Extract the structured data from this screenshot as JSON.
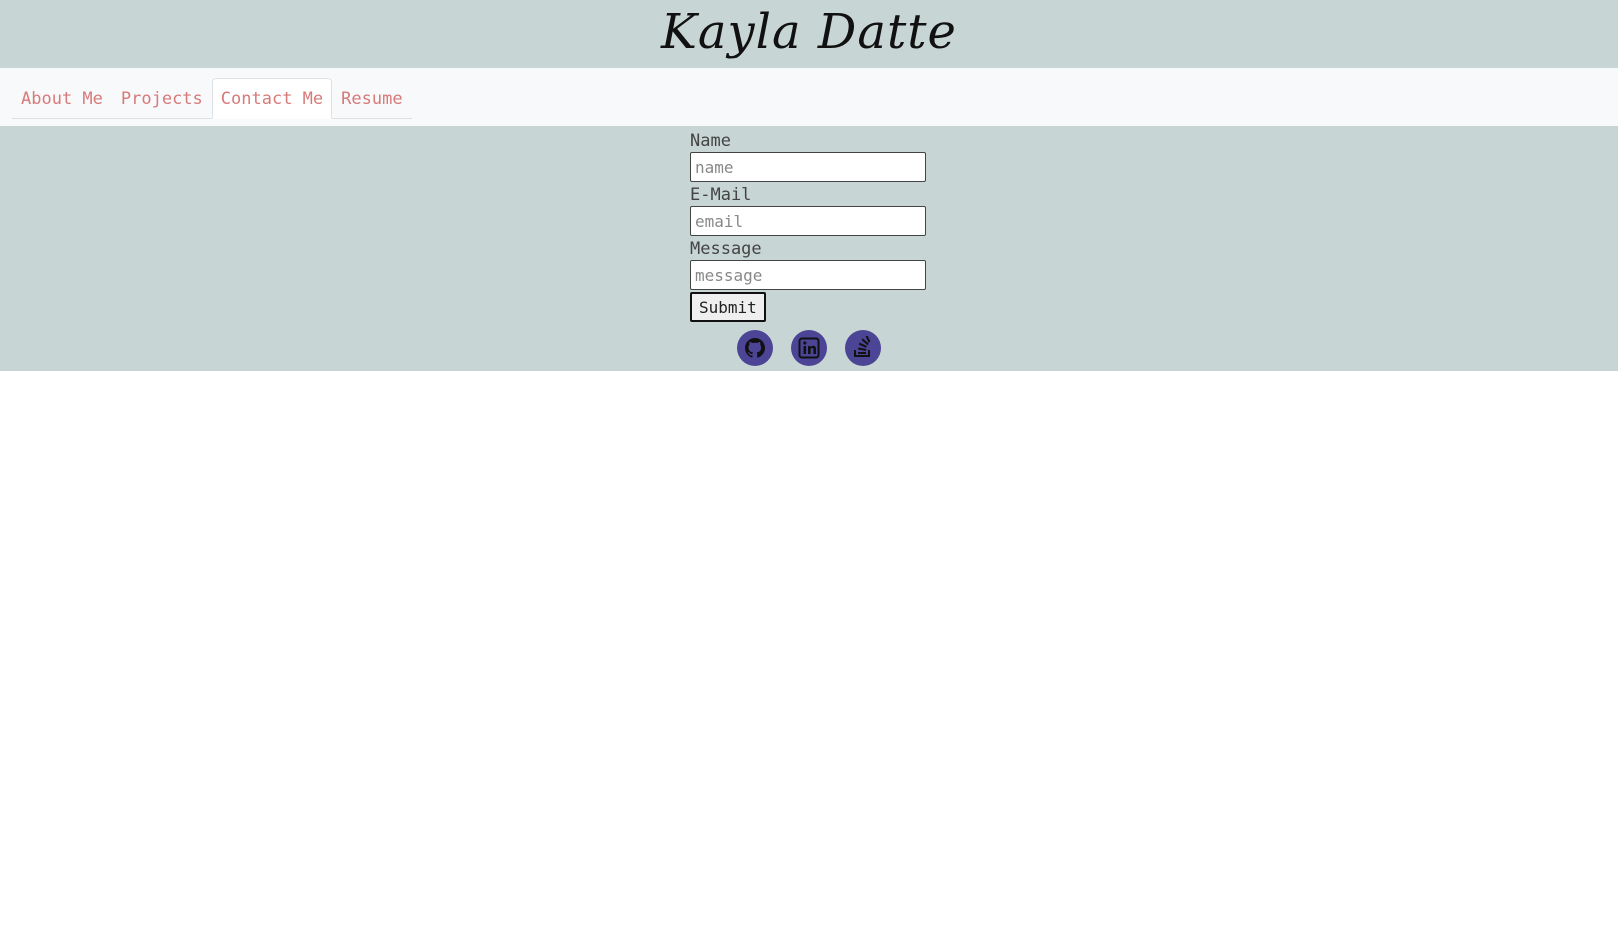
{
  "header": {
    "title": "Kayla Datte"
  },
  "nav": {
    "tabs": [
      {
        "label": "About Me"
      },
      {
        "label": "Projects"
      },
      {
        "label": "Contact Me"
      },
      {
        "label": "Resume"
      }
    ],
    "active": "Contact Me"
  },
  "form": {
    "name_label": "Name",
    "name_placeholder": "name",
    "email_label": "E-Mail",
    "email_placeholder": "email",
    "message_label": "Message",
    "message_placeholder": "message",
    "submit_label": "Submit"
  },
  "social": {
    "icons": [
      "github-icon",
      "linkedin-icon",
      "stackoverflow-icon"
    ]
  },
  "colors": {
    "header_bg": "#c7d5d4",
    "nav_bg": "#f7f9fa",
    "tab_text": "#d77a7a",
    "icon_bg": "#4c4495"
  }
}
